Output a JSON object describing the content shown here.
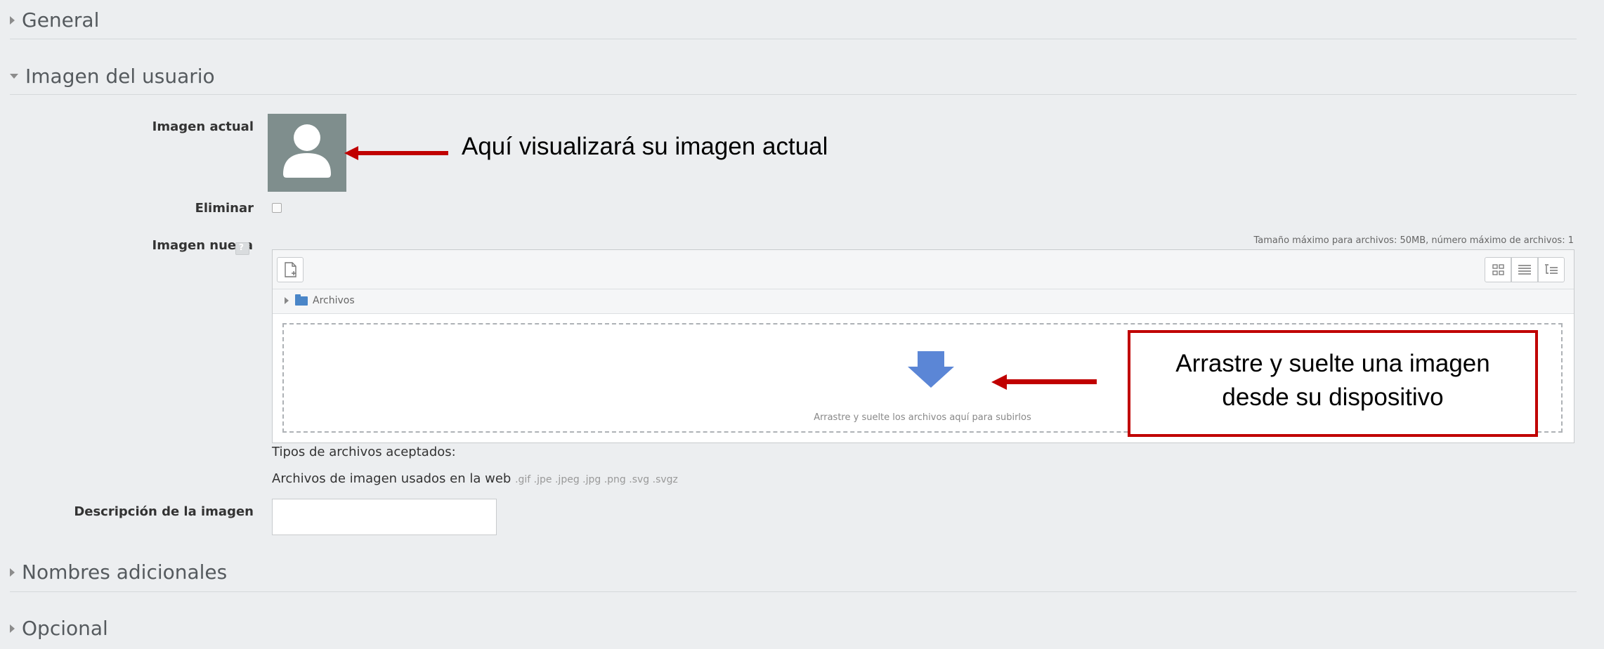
{
  "sections": {
    "general": {
      "title": "General"
    },
    "user_image": {
      "title": "Imagen del usuario"
    },
    "additional_names": {
      "title": "Nombres adicionales"
    },
    "optional": {
      "title": "Opcional"
    }
  },
  "fields": {
    "current_image_label": "Imagen actual",
    "delete_label": "Eliminar",
    "new_image_label": "Imagen nueva",
    "image_description_label": "Descripción de la imagen"
  },
  "filepicker": {
    "max_info": "Tamaño máximo para archivos: 50MB, número máximo de archivos: 1",
    "path_label": "Archivos",
    "drop_text": "Arrastre y suelte los archivos aquí para subirlos"
  },
  "accepted_types": {
    "heading": "Tipos de archivos aceptados:",
    "description": "Archivos de imagen usados en la web",
    "extensions": ".gif .jpe .jpeg .jpg .png .svg .svgz"
  },
  "annotations": {
    "current_image_note": "Aquí visualizará  su imagen actual",
    "drag_note_line1": "Arrastre y suelte una imagen",
    "drag_note_line2": "desde su dispositivo"
  },
  "colors": {
    "panel_bg": "#eceef0",
    "annotation_red": "#c00000",
    "avatar_bg": "#7f8e8d",
    "upload_arrow": "#5b86d6"
  },
  "icons": {
    "expand_collapsed": "triangle-right-icon",
    "expand_open": "triangle-down-icon",
    "avatar": "user-silhouette-icon",
    "help": "help-icon",
    "add_file": "add-file-icon",
    "view_icons": "grid-view-icon",
    "view_list": "list-view-icon",
    "view_tree": "tree-view-icon",
    "folder": "folder-icon",
    "upload": "down-arrow-icon"
  }
}
